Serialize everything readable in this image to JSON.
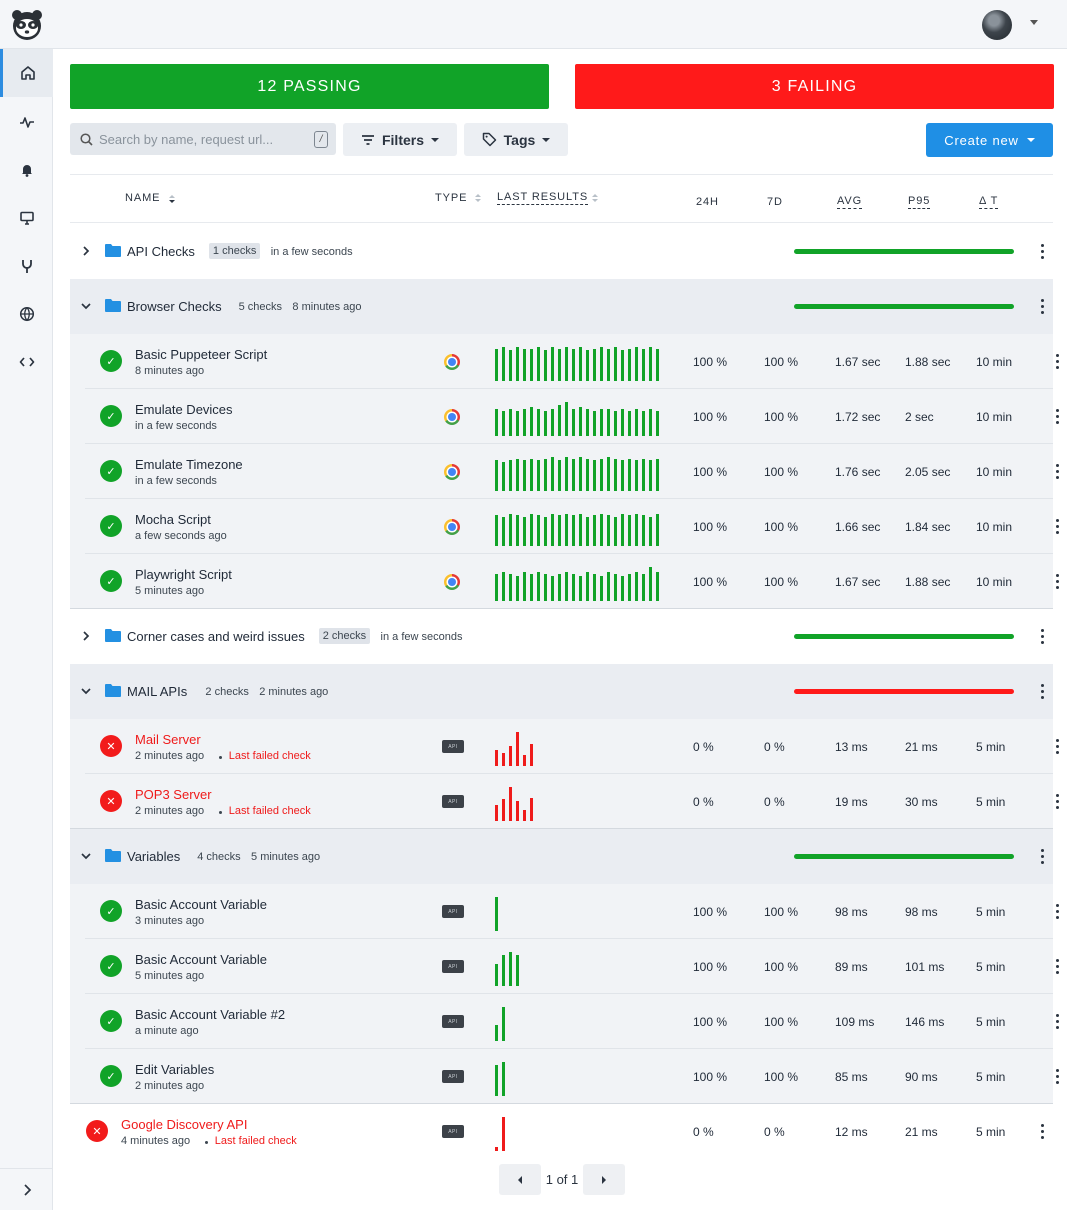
{
  "app": {
    "logo_icon": "raccoon-logo-icon",
    "user_avatar_icon": "user-avatar"
  },
  "sidebar": {
    "items": [
      {
        "name": "home",
        "icon": "home-icon",
        "active": true
      },
      {
        "name": "activity",
        "icon": "pulse-icon"
      },
      {
        "name": "alerts",
        "icon": "bell-icon"
      },
      {
        "name": "dashboards",
        "icon": "monitor-icon"
      },
      {
        "name": "integrations",
        "icon": "wrench-icon"
      },
      {
        "name": "locations",
        "icon": "globe-icon"
      },
      {
        "name": "code",
        "icon": "code-icon"
      }
    ],
    "expand_icon": "chevron-right-icon"
  },
  "summary": {
    "passing_label": "12 PASSING",
    "failing_label": "3 FAILING",
    "passing_color": "#11a328",
    "failing_color": "#ff1a1a"
  },
  "toolbar": {
    "search_placeholder": "Search by name, request url...",
    "search_shortcut": "/",
    "filters_label": "Filters",
    "tags_label": "Tags",
    "create_label": "Create new"
  },
  "table": {
    "headers": {
      "name": "NAME",
      "type": "TYPE",
      "last_results": "LAST RESULTS",
      "h24": "24H",
      "d7": "7D",
      "avg": "AVG",
      "p95": "P95",
      "delta_t": "Δ T"
    }
  },
  "groups": [
    {
      "name": "API Checks",
      "count": "1 checks",
      "time": "in a few seconds",
      "status_color": "#11a328",
      "expanded": false
    },
    {
      "name": "Browser Checks",
      "count": "5 checks",
      "time": "8 minutes ago",
      "status_color": "#11a328",
      "expanded": true,
      "checks": [
        {
          "name": "Basic Puppeteer Script",
          "time": "8 minutes ago",
          "type": "browser",
          "h24": "100 %",
          "d7": "100 %",
          "avg": "1.67 sec",
          "p95": "1.88 sec",
          "dt": "10 min",
          "results": [
            0.9,
            0.95,
            0.85,
            0.95,
            0.9,
            0.9,
            0.95,
            0.85,
            0.95,
            0.9,
            0.95,
            0.9,
            0.95,
            0.85,
            0.9,
            0.95,
            0.9,
            0.95,
            0.85,
            0.9,
            0.95,
            0.9,
            0.95,
            0.9
          ]
        },
        {
          "name": "Emulate Devices",
          "time": "in a few seconds",
          "type": "browser",
          "h24": "100 %",
          "d7": "100 %",
          "avg": "1.72 sec",
          "p95": "2 sec",
          "dt": "10 min",
          "results": [
            0.75,
            0.7,
            0.75,
            0.7,
            0.75,
            0.8,
            0.75,
            0.7,
            0.75,
            0.85,
            0.95,
            0.75,
            0.8,
            0.75,
            0.7,
            0.75,
            0.75,
            0.7,
            0.75,
            0.7,
            0.75,
            0.7,
            0.75,
            0.7
          ]
        },
        {
          "name": "Emulate Timezone",
          "time": "in a few seconds",
          "type": "browser",
          "h24": "100 %",
          "d7": "100 %",
          "avg": "1.76 sec",
          "p95": "2.05 sec",
          "dt": "10 min",
          "results": [
            0.85,
            0.8,
            0.85,
            0.9,
            0.85,
            0.9,
            0.85,
            0.9,
            0.95,
            0.85,
            0.95,
            0.9,
            0.95,
            0.9,
            0.85,
            0.9,
            0.95,
            0.9,
            0.85,
            0.9,
            0.85,
            0.9,
            0.85,
            0.9
          ]
        },
        {
          "name": "Mocha Script",
          "time": "a few seconds ago",
          "type": "browser",
          "h24": "100 %",
          "d7": "100 %",
          "avg": "1.66 sec",
          "p95": "1.84 sec",
          "dt": "10 min",
          "results": [
            0.85,
            0.8,
            0.9,
            0.85,
            0.8,
            0.9,
            0.85,
            0.8,
            0.9,
            0.85,
            0.9,
            0.85,
            0.9,
            0.8,
            0.85,
            0.9,
            0.85,
            0.8,
            0.9,
            0.85,
            0.9,
            0.85,
            0.8,
            0.9
          ]
        },
        {
          "name": "Playwright Script",
          "time": "5 minutes ago",
          "type": "browser",
          "h24": "100 %",
          "d7": "100 %",
          "avg": "1.67 sec",
          "p95": "1.88 sec",
          "dt": "10 min",
          "results": [
            0.75,
            0.8,
            0.75,
            0.7,
            0.8,
            0.75,
            0.8,
            0.75,
            0.7,
            0.75,
            0.8,
            0.75,
            0.7,
            0.8,
            0.75,
            0.7,
            0.8,
            0.75,
            0.7,
            0.75,
            0.8,
            0.75,
            0.95,
            0.8
          ]
        }
      ]
    },
    {
      "name": "Corner cases and weird issues",
      "count": "2 checks",
      "time": "in a few seconds",
      "status_color": "#11a328",
      "expanded": false
    },
    {
      "name": "MAIL APIs",
      "count": "2 checks",
      "time": "2 minutes ago",
      "status_color": "#ff1a1a",
      "expanded": true,
      "checks": [
        {
          "name": "Mail Server",
          "time": "2 minutes ago",
          "failed": true,
          "fail_note": "Last failed check",
          "type": "api",
          "h24": "0 %",
          "d7": "0 %",
          "avg": "13 ms",
          "p95": "21 ms",
          "dt": "5 min",
          "results": [
            0.45,
            0.35,
            0.55,
            0.95,
            0.3,
            0.6
          ]
        },
        {
          "name": "POP3 Server",
          "time": "2 minutes ago",
          "failed": true,
          "fail_note": "Last failed check",
          "type": "api",
          "h24": "0 %",
          "d7": "0 %",
          "avg": "19 ms",
          "p95": "30 ms",
          "dt": "5 min",
          "results": [
            0.45,
            0.6,
            0.95,
            0.55,
            0.3,
            0.65
          ]
        }
      ]
    },
    {
      "name": "Variables",
      "count": "4 checks",
      "time": "5 minutes ago",
      "status_color": "#11a328",
      "expanded": true,
      "checks": [
        {
          "name": "Basic Account Variable",
          "time": "3 minutes ago",
          "type": "api",
          "h24": "100 %",
          "d7": "100 %",
          "avg": "98 ms",
          "p95": "98 ms",
          "dt": "5 min",
          "results": [
            0.95
          ]
        },
        {
          "name": "Basic Account Variable",
          "time": "5 minutes ago",
          "type": "api",
          "h24": "100 %",
          "d7": "100 %",
          "avg": "89 ms",
          "p95": "101 ms",
          "dt": "5 min",
          "results": [
            0.6,
            0.85,
            0.95,
            0.85
          ]
        },
        {
          "name": "Basic Account Variable #2",
          "time": "a minute ago",
          "type": "api",
          "h24": "100 %",
          "d7": "100 %",
          "avg": "109 ms",
          "p95": "146 ms",
          "dt": "5 min",
          "results": [
            0.45,
            0.95
          ]
        },
        {
          "name": "Edit Variables",
          "time": "2 minutes ago",
          "type": "api",
          "h24": "100 %",
          "d7": "100 %",
          "avg": "85 ms",
          "p95": "90 ms",
          "dt": "5 min",
          "results": [
            0.85,
            0.95
          ]
        }
      ]
    }
  ],
  "ungrouped": [
    {
      "name": "Google Discovery API",
      "time": "4 minutes ago",
      "failed": true,
      "fail_note": "Last failed check",
      "type": "api",
      "h24": "0 %",
      "d7": "0 %",
      "avg": "12 ms",
      "p95": "21 ms",
      "dt": "5 min",
      "results": [
        0.12,
        0.95
      ]
    }
  ],
  "type_label_api": "API",
  "pagination": {
    "label": "1 of 1"
  }
}
